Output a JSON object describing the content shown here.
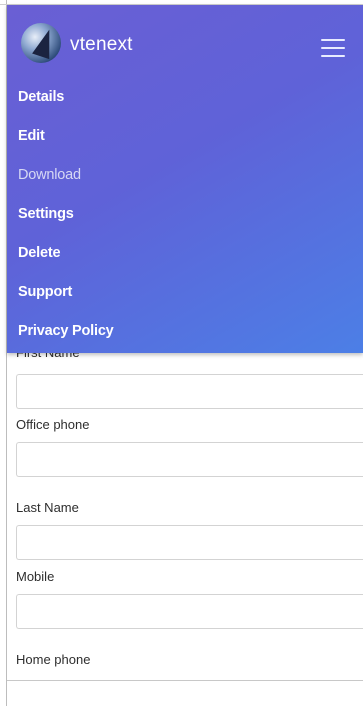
{
  "header": {
    "brand": "vtenext"
  },
  "menu": {
    "items": [
      {
        "label": "Details",
        "muted": false
      },
      {
        "label": "Edit",
        "muted": false
      },
      {
        "label": "Download",
        "muted": true
      },
      {
        "label": "Settings",
        "muted": false
      },
      {
        "label": "Delete",
        "muted": false
      },
      {
        "label": "Support",
        "muted": false
      },
      {
        "label": "Privacy Policy",
        "muted": false
      }
    ]
  },
  "form": {
    "fields": [
      {
        "label": "First Name",
        "value": ""
      },
      {
        "label": "Office phone",
        "value": ""
      },
      {
        "label": "Last Name",
        "value": ""
      },
      {
        "label": "Mobile",
        "value": ""
      },
      {
        "label": "Home phone",
        "value": ""
      }
    ]
  }
}
